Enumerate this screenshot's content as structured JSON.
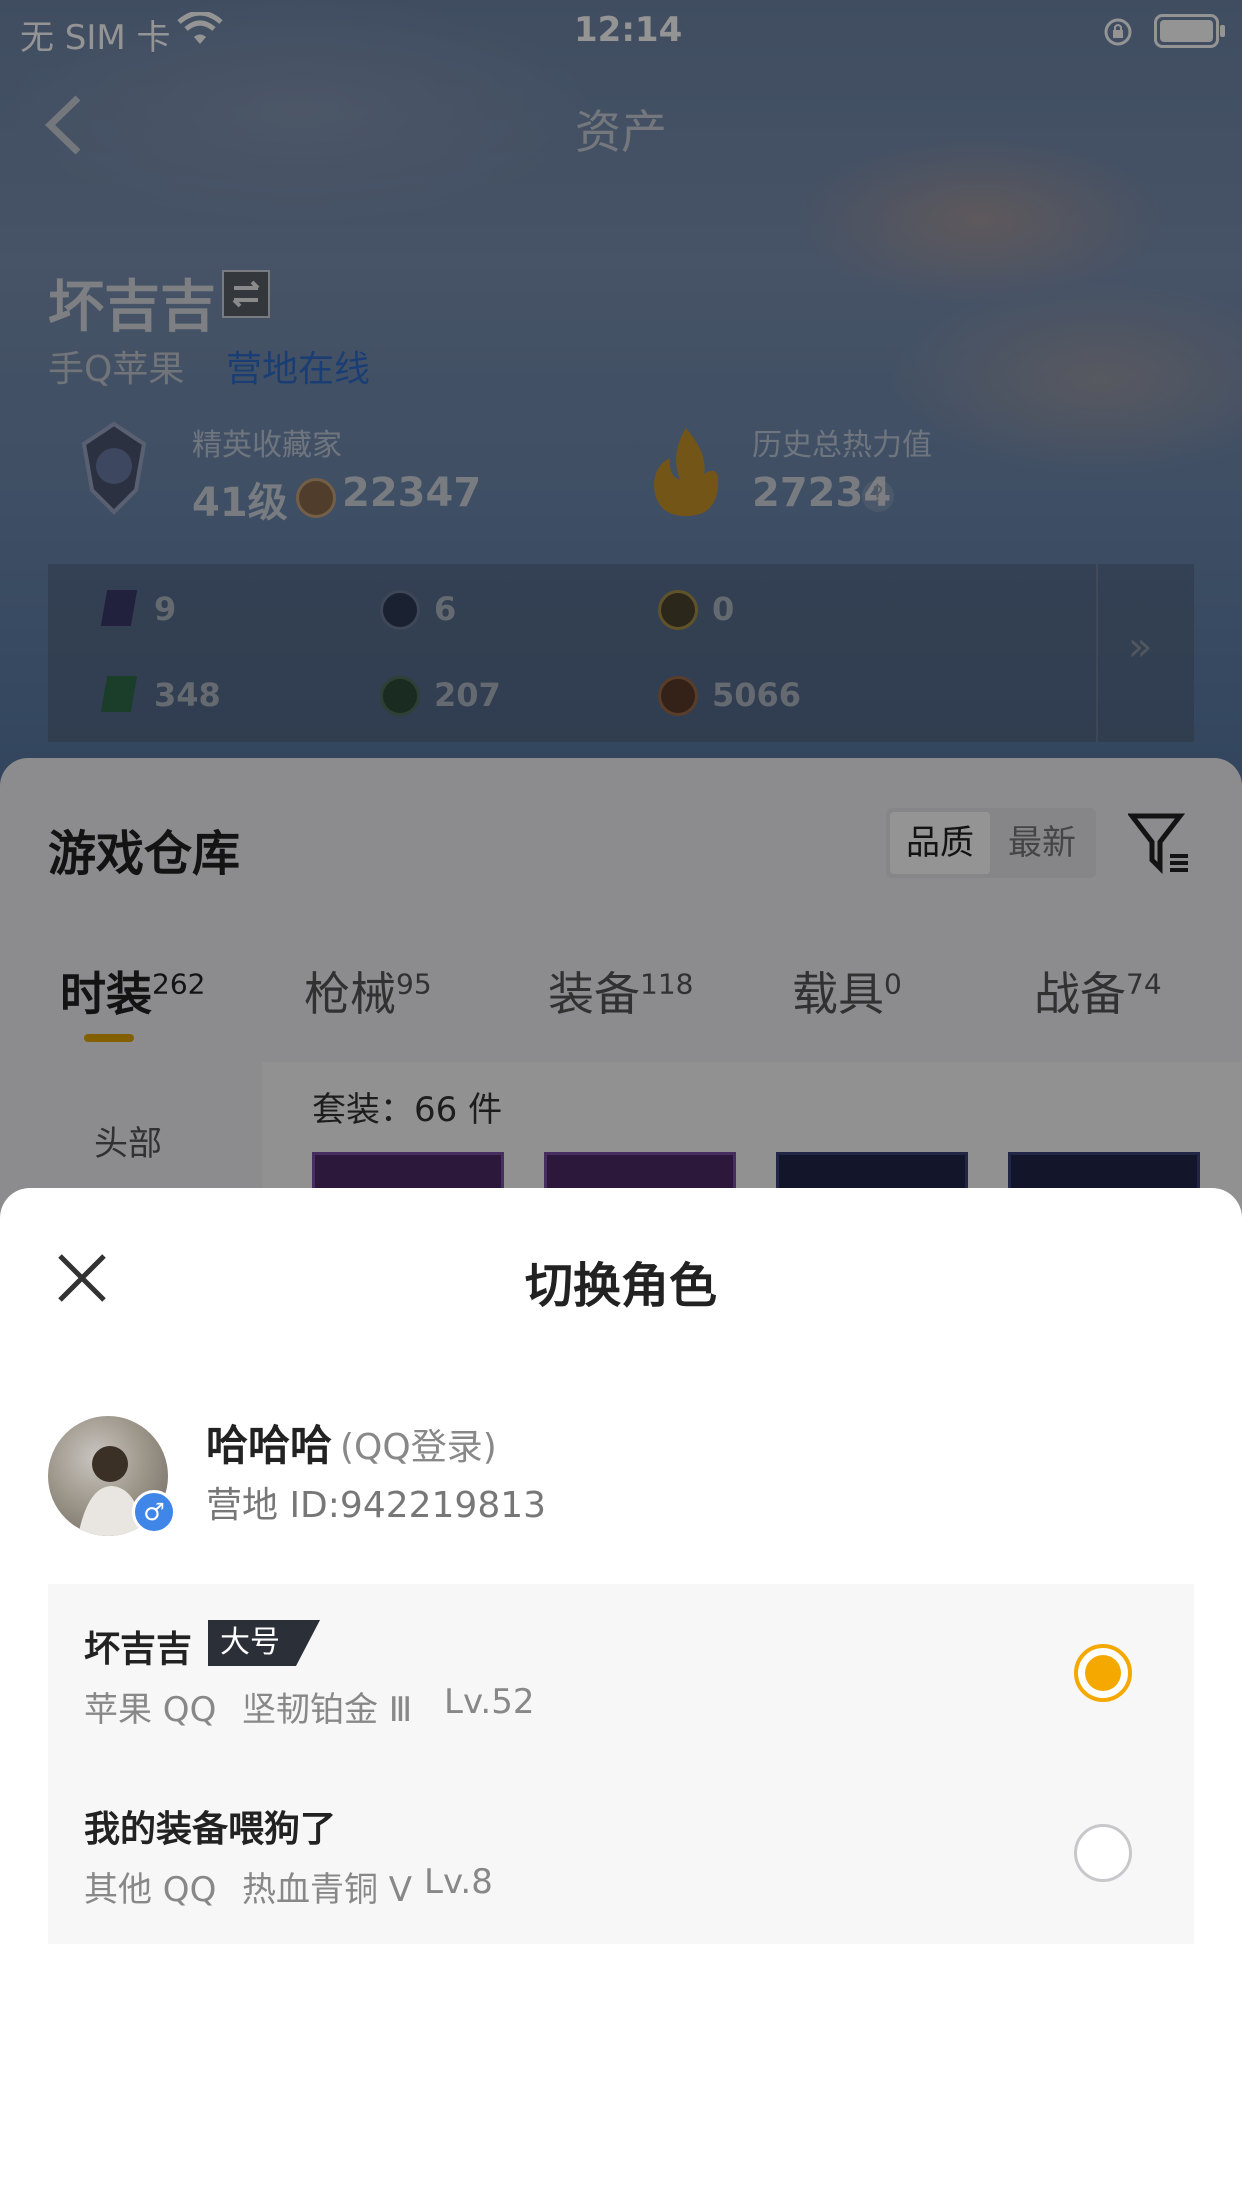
{
  "status_bar": {
    "carrier": "无 SIM 卡",
    "time": "12:14"
  },
  "header": {
    "title": "资产"
  },
  "profile": {
    "name": "坏吉吉",
    "platform": "手Q苹果",
    "online_status": "营地在线",
    "collector_title": "精英收藏家",
    "level": "41级",
    "collector_score": "22347",
    "heat_label": "历史总热力值",
    "heat_value": "27234"
  },
  "resources": {
    "row1": [
      "9",
      "6",
      "0"
    ],
    "row2": [
      "348",
      "207",
      "5066"
    ],
    "more": "»"
  },
  "warehouse": {
    "title": "游戏仓库",
    "sort_quality": "品质",
    "sort_newest": "最新",
    "tabs": [
      {
        "label": "时装",
        "count": "262"
      },
      {
        "label": "枪械",
        "count": "95"
      },
      {
        "label": "装备",
        "count": "118"
      },
      {
        "label": "载具",
        "count": "0"
      },
      {
        "label": "战备",
        "count": "74"
      }
    ],
    "side_category": "头部",
    "set_count": "套装：66 件"
  },
  "sheet": {
    "title": "切换角色",
    "user_name": "哈哈哈",
    "login_type": "(QQ登录)",
    "camp_id": "营地 ID:942219813",
    "gender_symbol": "♂",
    "roles": [
      {
        "name": "坏吉吉",
        "badge": "大号",
        "platform": "苹果 QQ",
        "rank": "坚韧铂金 Ⅲ",
        "level": "Lv.52",
        "selected": true
      },
      {
        "name": "我的装备喂狗了",
        "badge": "",
        "platform": "其他 QQ",
        "rank": "热血青铜 V",
        "level": "Lv.8",
        "selected": false
      }
    ]
  },
  "colors": {
    "accent": "#f5a800",
    "tab_underline": "#e0a400"
  }
}
